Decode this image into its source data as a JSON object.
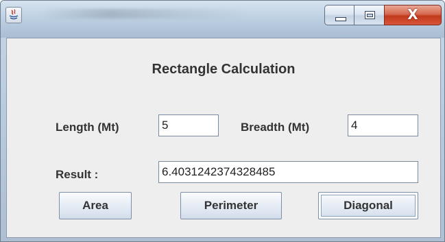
{
  "window": {
    "icon": "java-icon",
    "controls": {
      "minimize": "minimize-icon",
      "maximize": "maximize-icon",
      "close": "X"
    }
  },
  "form": {
    "heading": "Rectangle Calculation",
    "length_label": "Length (Mt)",
    "length_value": "5",
    "breadth_label": "Breadth (Mt)",
    "breadth_value": "4",
    "result_label": "Result :",
    "result_value": "6.4031242374328485"
  },
  "buttons": {
    "area": "Area",
    "perimeter": "Perimeter",
    "diagonal": "Diagonal"
  },
  "colors": {
    "accent_close": "#c13a1c",
    "panel_bg": "#eeeeee"
  }
}
